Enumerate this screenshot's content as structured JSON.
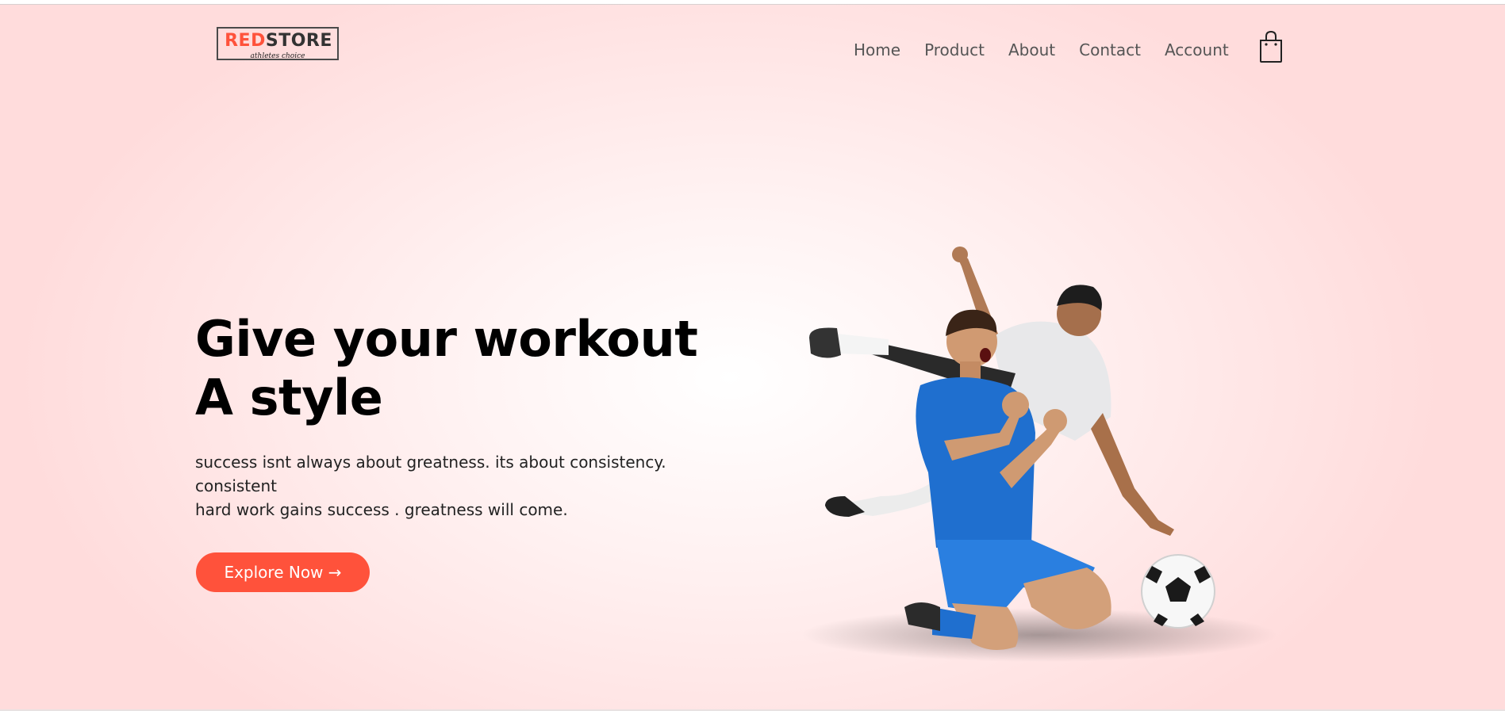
{
  "brand": {
    "part_red": "RED",
    "part_dark": "STORE",
    "tagline": "athletes choice",
    "accent_color": "#ff523b"
  },
  "nav": {
    "items": [
      {
        "label": "Home"
      },
      {
        "label": "Product"
      },
      {
        "label": "About"
      },
      {
        "label": "Contact"
      },
      {
        "label": "Account"
      }
    ],
    "cart_icon": "shopping-bag-icon"
  },
  "hero": {
    "headline": "Give your workout A style",
    "description_lines": [
      "success isnt always about greatness. its about consistency.",
      "consistent",
      "hard work gains success . greatness will come."
    ],
    "cta_label": "Explore Now →",
    "image_subject": "two football players celebrating with a soccer ball"
  }
}
